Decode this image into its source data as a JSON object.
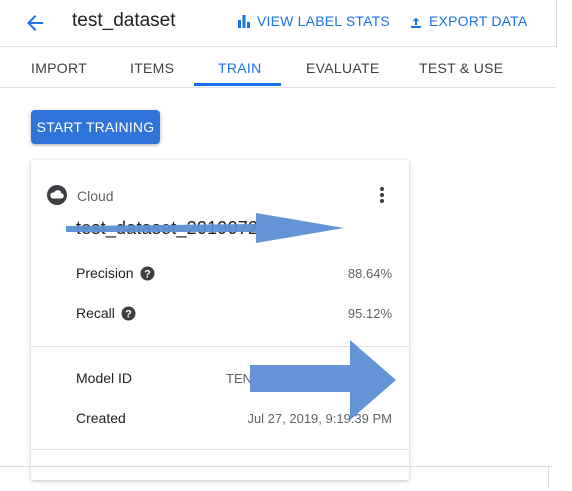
{
  "header": {
    "back_icon": "arrow-back-icon",
    "title": "test_dataset",
    "view_stats_label": "VIEW LABEL STATS",
    "view_stats_icon": "bar-chart-icon",
    "export_label": "EXPORT DATA",
    "export_icon": "upload-icon",
    "accent_color": "#1a73e8"
  },
  "tabs": [
    {
      "label": "IMPORT",
      "active": false
    },
    {
      "label": "ITEMS",
      "active": false
    },
    {
      "label": "TRAIN",
      "active": true
    },
    {
      "label": "EVALUATE",
      "active": false
    },
    {
      "label": "TEST & USE",
      "active": false
    }
  ],
  "actions": {
    "start_training_label": "START TRAINING",
    "button_color": "#2f74d8"
  },
  "model_card": {
    "cloud_icon": "cloud-icon",
    "deployment": "Cloud",
    "more_icon": "more-vert-icon",
    "model_name": "test_dataset_2019072",
    "metrics": [
      {
        "label": "Precision",
        "value": "88.64%",
        "help_icon": "help-icon"
      },
      {
        "label": "Recall",
        "value": "95.12%",
        "help_icon": "help-icon"
      }
    ],
    "details": [
      {
        "label": "Model ID",
        "value": "TEN"
      },
      {
        "label": "Created",
        "value": "Jul 27, 2019, 9:19:39 PM"
      }
    ]
  },
  "annotations": {
    "arrow_color": "#5b8fd4"
  }
}
